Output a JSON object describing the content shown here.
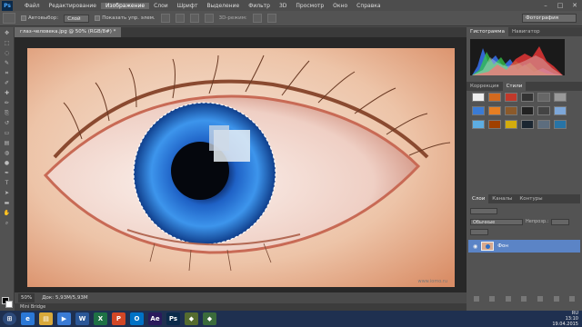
{
  "app": {
    "logo": "Ps"
  },
  "menu": [
    "Файл",
    "Редактирование",
    "Изображение",
    "Слои",
    "Шрифт",
    "Выделение",
    "Фильтр",
    "3D",
    "Просмотр",
    "Окно",
    "Справка"
  ],
  "menu_active": "Изображение",
  "options": {
    "autoselect_label": "Автовыбор:",
    "autoselect_value": "Слой",
    "show_controls_label": "Показать упр. элем.",
    "mode_3d_label": "3D-режим:",
    "workspace": "Фотография"
  },
  "document": {
    "tab": "глаз-человека.jpg @ 50% (RGB/8#) *",
    "zoom": "50%",
    "doc_size": "Док: 5,93M/5,93M",
    "watermark": "www.iomo.ru"
  },
  "minibridge": "Mini Bridge",
  "panels": {
    "top_tabs": [
      "Гистограмма",
      "Навигатор"
    ],
    "mid_tabs": [
      "Коррекция",
      "Стили"
    ],
    "layers_tabs": [
      "Слои",
      "Каналы",
      "Контуры"
    ],
    "blend_mode": "Обычные",
    "opacity_label": "Непрозр.:",
    "layer_name": "Фон"
  },
  "taskbar": {
    "lang": "RU",
    "time": "13:10",
    "date": "19.04.2015",
    "apps": [
      {
        "name": "ie",
        "label": "e",
        "color": "#2b78d6"
      },
      {
        "name": "explorer",
        "label": "▤",
        "color": "#d9a93a"
      },
      {
        "name": "media",
        "label": "▶",
        "color": "#3a7bd5"
      },
      {
        "name": "word",
        "label": "W",
        "color": "#2b5797"
      },
      {
        "name": "excel",
        "label": "X",
        "color": "#1e7145"
      },
      {
        "name": "powerpoint",
        "label": "P",
        "color": "#d24726"
      },
      {
        "name": "outlook",
        "label": "O",
        "color": "#0072c6"
      },
      {
        "name": "aftereffects",
        "label": "Ae",
        "color": "#2a1a5c"
      },
      {
        "name": "photoshop",
        "label": "Ps",
        "color": "#0b2a4a"
      },
      {
        "name": "app1",
        "label": "◆",
        "color": "#556b2f"
      },
      {
        "name": "app2",
        "label": "◆",
        "color": "#3b6b3b"
      }
    ]
  },
  "colors": {
    "accent": "#5b84c6",
    "iris": "#2f7fe0",
    "panel_bg": "#535353"
  }
}
